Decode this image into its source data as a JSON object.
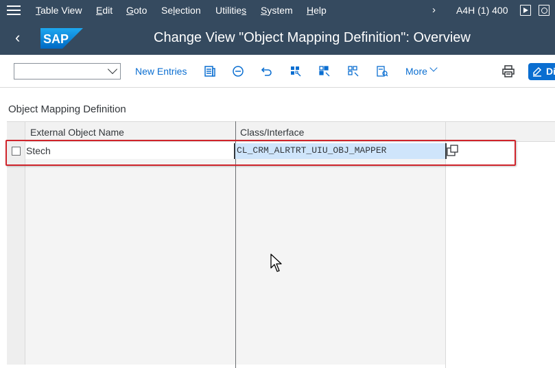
{
  "menubar": {
    "items": [
      "Table View",
      "Edit",
      "Goto",
      "Selection",
      "Utilities",
      "System",
      "Help"
    ],
    "system_info": "A4H (1) 400"
  },
  "titlebar": {
    "logo_text": "SAP",
    "title": "Change View \"Object Mapping Definition\": Overview"
  },
  "toolbar": {
    "combo_value": "",
    "new_entries": "New Entries",
    "more": "More",
    "display_label": "Di"
  },
  "section": {
    "title": "Object Mapping Definition"
  },
  "table": {
    "columns": [
      "External Object Name",
      "Class/Interface"
    ],
    "rows": [
      {
        "name": "Stech",
        "class_interface": "CL_CRM_ALRTRT_UIU_OBJ_MAPPER",
        "selected": false
      }
    ]
  },
  "colors": {
    "shell": "#354a5f",
    "accent": "#0a6ed1",
    "highlight": "#d0232a",
    "selection": "#cfe5fb"
  },
  "icons": [
    "menu-icon",
    "chevron-right-icon",
    "play-icon",
    "help-icon",
    "back-icon",
    "sap-logo",
    "details-icon",
    "delete-icon",
    "undo-icon",
    "select-all-icon",
    "select-block-icon",
    "deselect-all-icon",
    "choose-icon",
    "chevron-down-icon",
    "print-icon",
    "edit-icon",
    "value-help-icon",
    "mouse-cursor-icon"
  ]
}
